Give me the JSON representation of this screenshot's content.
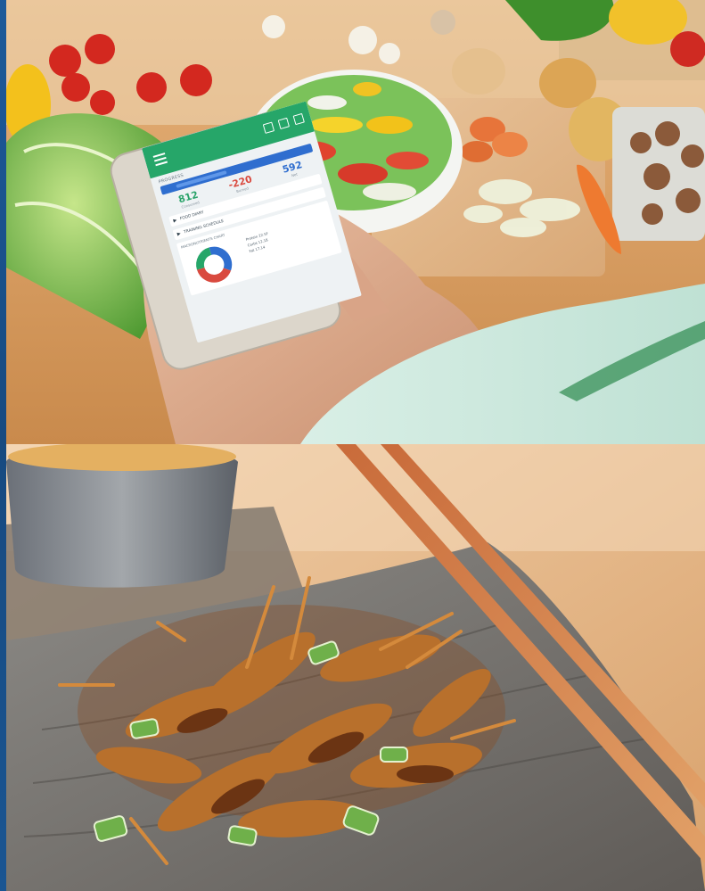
{
  "photos": {
    "top": {
      "app_screen": {
        "section_label": "PROGRESS",
        "stats": [
          {
            "value": "812",
            "label": "Consumed"
          },
          {
            "value": "-220",
            "label": "Burned"
          },
          {
            "value": "592",
            "label": "Net"
          }
        ],
        "rows": [
          "FOOD DIARY",
          "TRAINING SCHEDULE"
        ],
        "chart_title": "MACRONUTRIENTS CHART",
        "legend": [
          "Protein 22.5F",
          "Carbs 12.18",
          "Fat 17.14"
        ]
      }
    },
    "bottom": {}
  },
  "colors": {
    "app_green": "#26a669",
    "app_blue": "#2f6ecf",
    "app_red": "#d94a3f",
    "wood": "#c8874a"
  }
}
